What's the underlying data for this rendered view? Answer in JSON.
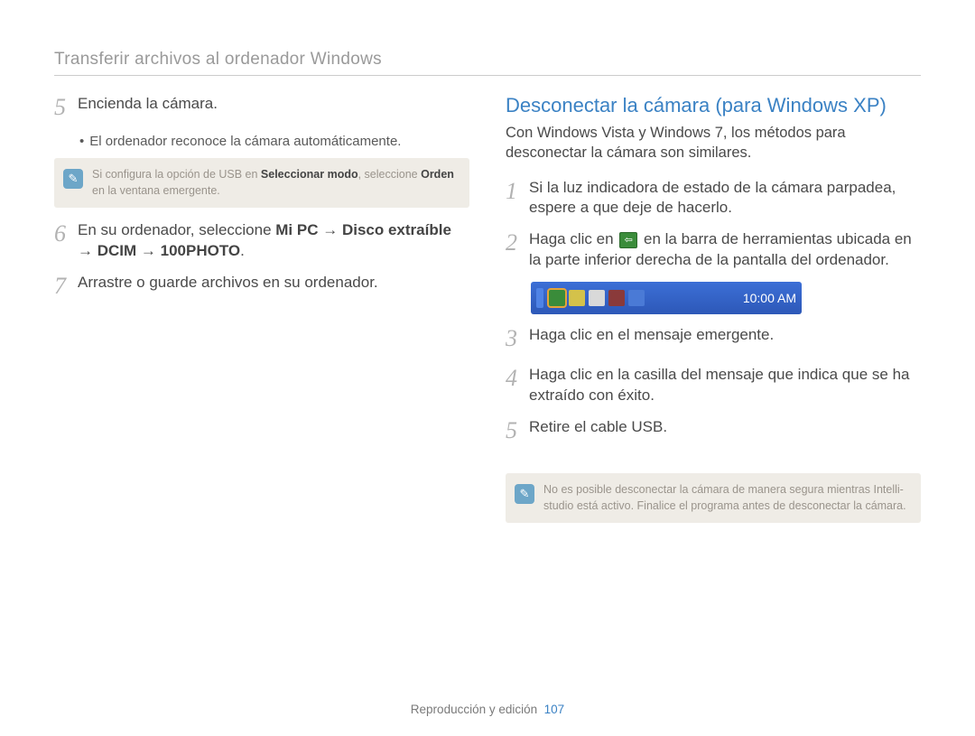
{
  "page": {
    "title": "Transferir archivos al ordenador Windows",
    "footer_section": "Reproducción y edición",
    "footer_page": "107"
  },
  "left": {
    "step5": {
      "num": "5",
      "text": "Encienda la cámara."
    },
    "step5_bullet": "El ordenador reconoce la cámara automáticamente.",
    "note1_a": "Si configura la opción de USB en ",
    "note1_b_bold": "Seleccionar modo",
    "note1_c": ", seleccione ",
    "note1_d_bold": "Orden",
    "note1_e": " en la ventana emergente.",
    "step6": {
      "num": "6",
      "a": "En su ordenador, seleccione ",
      "b_bold": "Mi PC",
      "c": " → ",
      "d_bold": "Disco extraíble",
      "e": " → ",
      "f_bold": "DCIM",
      "g": " → ",
      "h_bold": "100PHOTO",
      "i": "."
    },
    "step7": {
      "num": "7",
      "text": "Arrastre o guarde archivos en su ordenador."
    }
  },
  "right": {
    "heading": "Desconectar la cámara (para Windows XP)",
    "intro": "Con Windows Vista y Windows 7, los métodos para desconectar la cámara son similares.",
    "step1": {
      "num": "1",
      "text": "Si la luz indicadora de estado de la cámara parpadea, espere a que deje de hacerlo."
    },
    "step2": {
      "num": "2",
      "a": "Haga clic en ",
      "b": " en la barra de herramientas ubicada en la parte inferior derecha de la pantalla del ordenador."
    },
    "taskbar_time": "10:00 AM",
    "step3": {
      "num": "3",
      "text": "Haga clic en el mensaje emergente."
    },
    "step4": {
      "num": "4",
      "text": "Haga clic en la casilla del mensaje que indica que se ha extraído con éxito."
    },
    "step5": {
      "num": "5",
      "text": "Retire el cable USB."
    },
    "note2": "No es posible desconectar la cámara de manera segura mientras Intelli-studio está activo. Finalice el programa antes de desconectar la cámara."
  }
}
